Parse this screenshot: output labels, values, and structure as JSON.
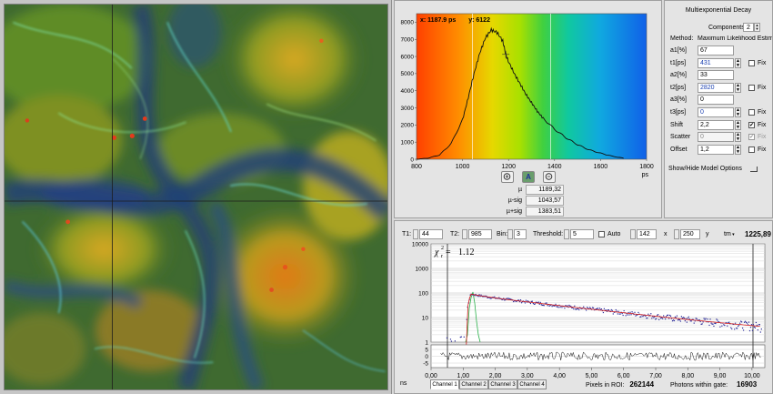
{
  "histogram": {
    "cursor_x": "x: 1187.9  ps",
    "cursor_y": "y: 6122",
    "unit": "ps",
    "x_ticks": [
      "800",
      "1000",
      "1200",
      "1400",
      "1600",
      "1800"
    ],
    "y_ticks": [
      "0",
      "1000",
      "2000",
      "3000",
      "4000",
      "5000",
      "6000",
      "7000",
      "8000"
    ],
    "auto_button": "A",
    "stats": [
      {
        "label": "µ",
        "value": "1189,32"
      },
      {
        "label": "µ-sig",
        "value": "1043,57"
      },
      {
        "label": "µ+sig",
        "value": "1383,51"
      }
    ]
  },
  "chart_data": {
    "type": "line",
    "title": "",
    "xlabel": "ps",
    "ylabel": "",
    "xlim": [
      800,
      1800
    ],
    "ylim": [
      0,
      8500
    ],
    "x": [
      800,
      850,
      900,
      950,
      1000,
      1025,
      1050,
      1075,
      1100,
      1125,
      1150,
      1175,
      1188,
      1200,
      1225,
      1250,
      1275,
      1300,
      1325,
      1350,
      1400,
      1450,
      1500,
      1550,
      1600,
      1650,
      1700
    ],
    "series": [
      {
        "values": [
          0,
          60,
          250,
          900,
          2300,
          3600,
          5000,
          6200,
          7100,
          7550,
          7400,
          6900,
          6122,
          5700,
          5000,
          4400,
          3800,
          3300,
          2800,
          2400,
          1750,
          1250,
          850,
          550,
          350,
          180,
          60
        ]
      }
    ],
    "markers": [
      1043.57,
      1189.32,
      1383.51
    ]
  },
  "parameters": {
    "title": "Multiexponential Decay",
    "components_label": "Components:",
    "components_value": "2",
    "method_label": "Method:",
    "method_value": "Maximum Likelihood Estimation",
    "rows": [
      {
        "label": "a1[%]",
        "value": "67",
        "style": "",
        "fix": false,
        "has_fix": false
      },
      {
        "label": "t1[ps]",
        "value": "431",
        "style": "blue",
        "fix": false,
        "has_fix": true
      },
      {
        "label": "a2[%]",
        "value": "33",
        "style": "",
        "fix": false,
        "has_fix": false
      },
      {
        "label": "t2[ps]",
        "value": "2820",
        "style": "blue",
        "fix": false,
        "has_fix": true
      },
      {
        "label": "a3[%]",
        "value": "0",
        "style": "",
        "fix": false,
        "has_fix": false
      },
      {
        "label": "t3[ps]",
        "value": "0",
        "style": "blue",
        "fix": false,
        "has_fix": true
      },
      {
        "label": "Shift",
        "value": "2,2",
        "style": "",
        "fix": true,
        "has_fix": true
      },
      {
        "label": "Scatter",
        "value": "0",
        "style": "gray",
        "fix": true,
        "has_fix": true
      },
      {
        "label": "Offset",
        "value": "1,2",
        "style": "",
        "fix": false,
        "has_fix": true
      }
    ],
    "fix_label": "Fix",
    "show_hide_label": "Show/Hide Model Options"
  },
  "decay": {
    "t1_label": "T1:",
    "t1_value": "44",
    "t2_label": "T2:",
    "t2_value": "985",
    "bin_label": "Bin:",
    "bin_value": "3",
    "threshold_label": "Threshold:",
    "threshold_value": "5",
    "auto_label": "Auto",
    "x_value": "142",
    "x_label": "x",
    "y_value": "250",
    "y_label": "y",
    "tm_label": "tm",
    "tm_value": "1225,89",
    "chi_label": "χ",
    "chi_value": "1.12",
    "y_ticks": [
      "1",
      "10",
      "100",
      "1000",
      "10000"
    ],
    "res_ticks": [
      "5",
      "0",
      "-5"
    ],
    "x_ticks": [
      "0,00",
      "1,00",
      "2,00",
      "3,00",
      "4,00",
      "5,00",
      "6,00",
      "7,00",
      "8,00",
      "9,00",
      "10,00"
    ],
    "ns_label": "ns",
    "tabs": [
      "Channel 1",
      "Channel 2",
      "Channel 3",
      "Channel 4"
    ],
    "pixels_label": "Pixels in ROI:",
    "pixels_value": "262144",
    "photons_label": "Photons within gate:",
    "photons_value": "16903"
  }
}
